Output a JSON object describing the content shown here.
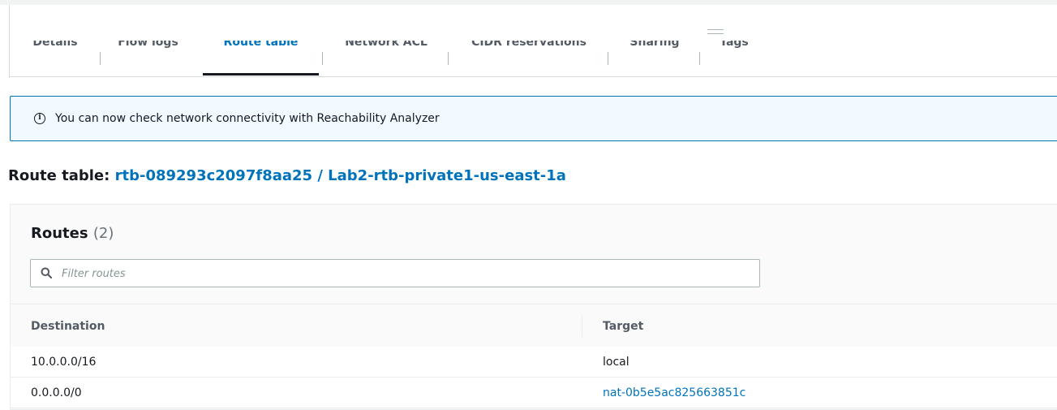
{
  "tabs": [
    {
      "label": "Details",
      "active": false
    },
    {
      "label": "Flow logs",
      "active": false
    },
    {
      "label": "Route table",
      "active": true
    },
    {
      "label": "Network ACL",
      "active": false
    },
    {
      "label": "CIDR reservations",
      "active": false
    },
    {
      "label": "Sharing",
      "active": false
    },
    {
      "label": "Tags",
      "active": false
    }
  ],
  "alert": {
    "icon": "info-icon",
    "text": "You can now check network connectivity with Reachability Analyzer"
  },
  "route_table": {
    "label": "Route table: ",
    "link": "rtb-089293c2097f8aa25 / Lab2-rtb-private1-us-east-1a"
  },
  "routes": {
    "title": "Routes",
    "count": "(2)",
    "filter_placeholder": "Filter routes",
    "columns": [
      "Destination",
      "Target"
    ],
    "rows": [
      {
        "destination": "10.0.0.0/16",
        "target": "local",
        "target_is_link": false
      },
      {
        "destination": "0.0.0.0/0",
        "target": "nat-0b5e5ac825663851c",
        "target_is_link": true
      }
    ]
  },
  "colors": {
    "link": "#0073bb",
    "alert_border": "#0073bb",
    "alert_bg": "#f1faff",
    "text": "#16191f"
  }
}
